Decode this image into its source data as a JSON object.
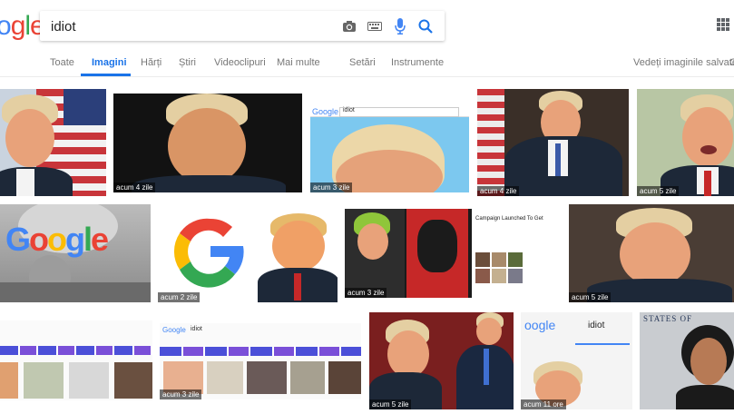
{
  "search": {
    "query": "idiot"
  },
  "logo": {
    "text": "ogle"
  },
  "tabs": [
    {
      "label": "Toate"
    },
    {
      "label": "Imagini"
    },
    {
      "label": "Hărți"
    },
    {
      "label": "Știri"
    },
    {
      "label": "Videoclipuri"
    },
    {
      "label": "Mai multe"
    },
    {
      "label": "Setări"
    },
    {
      "label": "Instrumente"
    }
  ],
  "saved": {
    "label": "Vedeți imaginile salvate",
    "overflow": "C"
  },
  "thumbs": {
    "t2": "acum 4 zile",
    "t3": "acum 3 zile",
    "t4": "acum 4 zile",
    "t5": "acum 5 zile",
    "t7": "acum 2 zile",
    "t8": "acum 3 zile",
    "t9": "acum 5 zile",
    "t11": "acum 3 zile",
    "t12": "acum 5 zile",
    "t13": "acum 11 ore"
  },
  "mini_google": {
    "t3_query": "idiot",
    "t11_query": "idiot",
    "t13_query": "idiot",
    "t8_title": "Campaign Launched To Get",
    "t14_text": "STATES OF"
  },
  "colors": {
    "accent": "#1a73e8",
    "label_bg": "rgba(0,0,0,0.55)"
  }
}
